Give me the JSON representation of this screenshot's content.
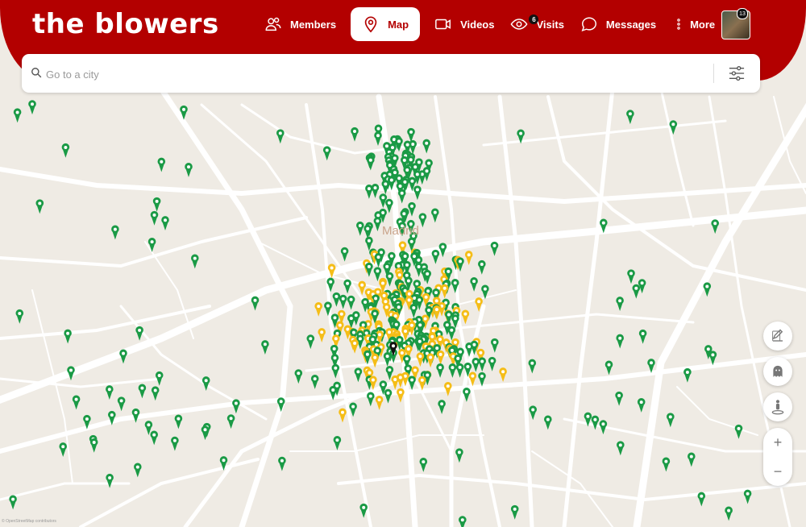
{
  "app": {
    "logo": "the blowers"
  },
  "nav": [
    {
      "label": "Members",
      "icon": "members-icon"
    },
    {
      "label": "Map",
      "icon": "map-pin-icon",
      "active": true
    },
    {
      "label": "Videos",
      "icon": "video-icon"
    },
    {
      "label": "Visits",
      "icon": "eye-icon",
      "badge": "6"
    },
    {
      "label": "Messages",
      "icon": "chat-bubble-icon"
    },
    {
      "label": "More",
      "icon": "more-dots-icon"
    }
  ],
  "user": {
    "notification_count": "13"
  },
  "search": {
    "placeholder": "Go to a city"
  },
  "map": {
    "city_label": "Madrid",
    "attribution": "© OpenStreetMap contributors",
    "zoom_in_label": "+",
    "zoom_out_label": "−"
  },
  "colors": {
    "brand": "#b30000",
    "marker_green": "#1a9a45",
    "marker_yellow": "#f5bd17",
    "marker_self": "#111111",
    "map_bg": "#efebe4",
    "road": "#ffffff"
  },
  "controls": [
    "edit-icon",
    "ghost-icon",
    "street-view-icon"
  ]
}
